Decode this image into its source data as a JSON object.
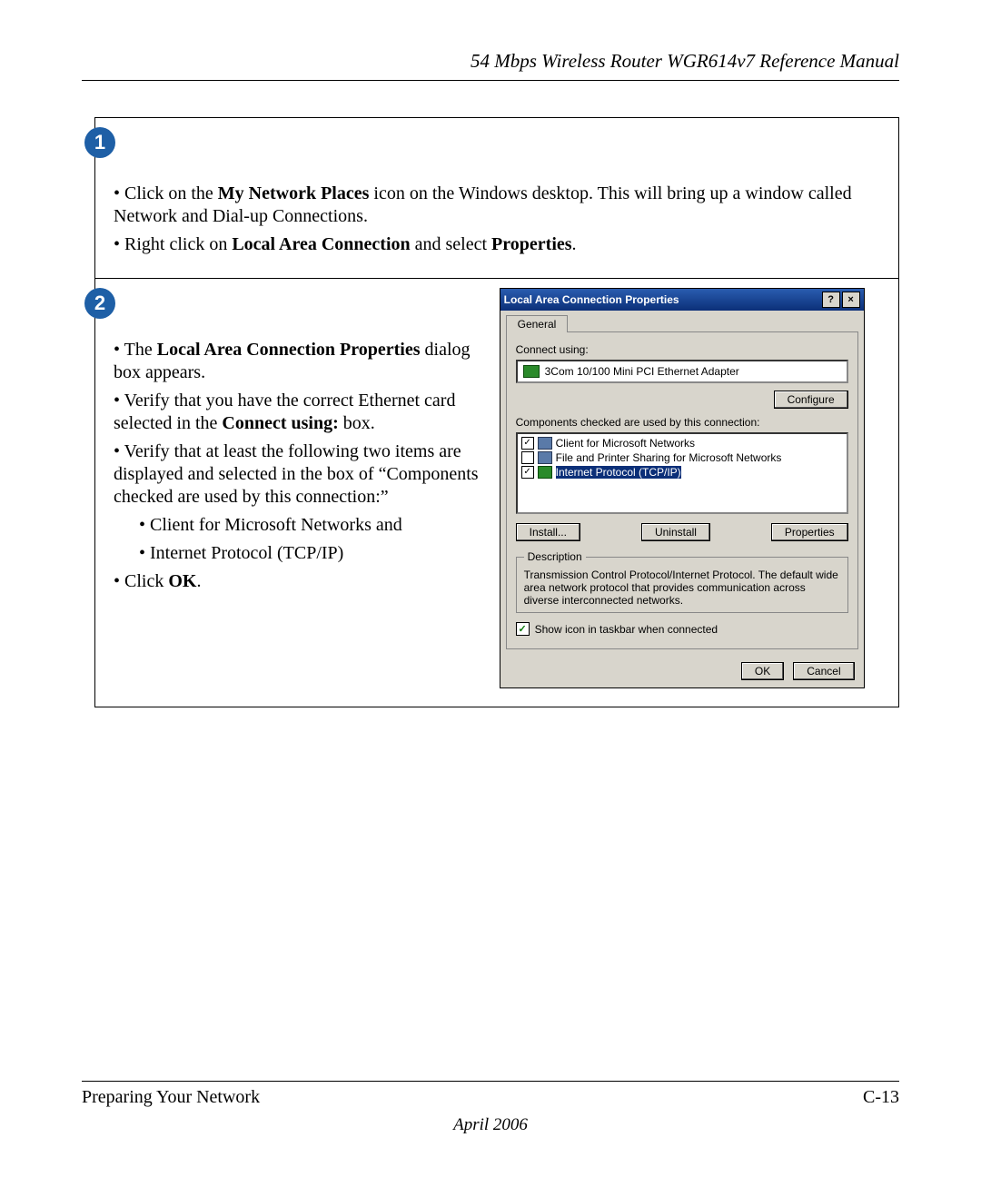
{
  "header": {
    "title": "54 Mbps Wireless Router WGR614v7 Reference Manual"
  },
  "step1": {
    "badge": "1",
    "line1_pre": "Click on the ",
    "line1_bold": "My Network Places",
    "line1_post": " icon on the Windows desktop.  This will bring up a window called Network and Dial-up Connections.",
    "line2_pre": "Right click on ",
    "line2_bold1": "Local Area Connection",
    "line2_mid": " and select ",
    "line2_bold2": "Properties",
    "line2_post": "."
  },
  "step2": {
    "badge": "2",
    "b1_pre": "The ",
    "b1_bold": "Local Area Connection Properties",
    "b1_post": " dialog box appears.",
    "b2_pre": "Verify that you have the correct Ethernet card selected in the ",
    "b2_bold": "Connect using:",
    "b2_post": " box.",
    "b3": "Verify that at least the following two items are displayed and selected in the box of “Components checked are used by this connection:”",
    "sub1": "Client for Microsoft Networks and",
    "sub2": "Internet Protocol (TCP/IP)",
    "b4_pre": "Click ",
    "b4_bold": "OK",
    "b4_post": "."
  },
  "dialog": {
    "title": "Local Area Connection Properties",
    "help_glyph": "?",
    "close_glyph": "×",
    "tab_general": "General",
    "connect_using_label": "Connect using:",
    "adapter": "3Com 10/100 Mini PCI Ethernet Adapter",
    "configure_btn": "Configure",
    "components_label": "Components checked are used by this connection:",
    "comp1": "Client for Microsoft Networks",
    "comp2": "File and Printer Sharing for Microsoft Networks",
    "comp3": "Internet Protocol (TCP/IP)",
    "install_btn": "Install...",
    "uninstall_btn": "Uninstall",
    "properties_btn": "Properties",
    "desc_legend": "Description",
    "desc_text": "Transmission Control Protocol/Internet Protocol. The default wide area network protocol that provides communication across diverse interconnected networks.",
    "show_icon": "Show icon in taskbar when connected",
    "ok_btn": "OK",
    "cancel_btn": "Cancel",
    "check_glyph": "✓"
  },
  "footer": {
    "section": "Preparing Your Network",
    "page": "C-13",
    "date": "April 2006"
  }
}
